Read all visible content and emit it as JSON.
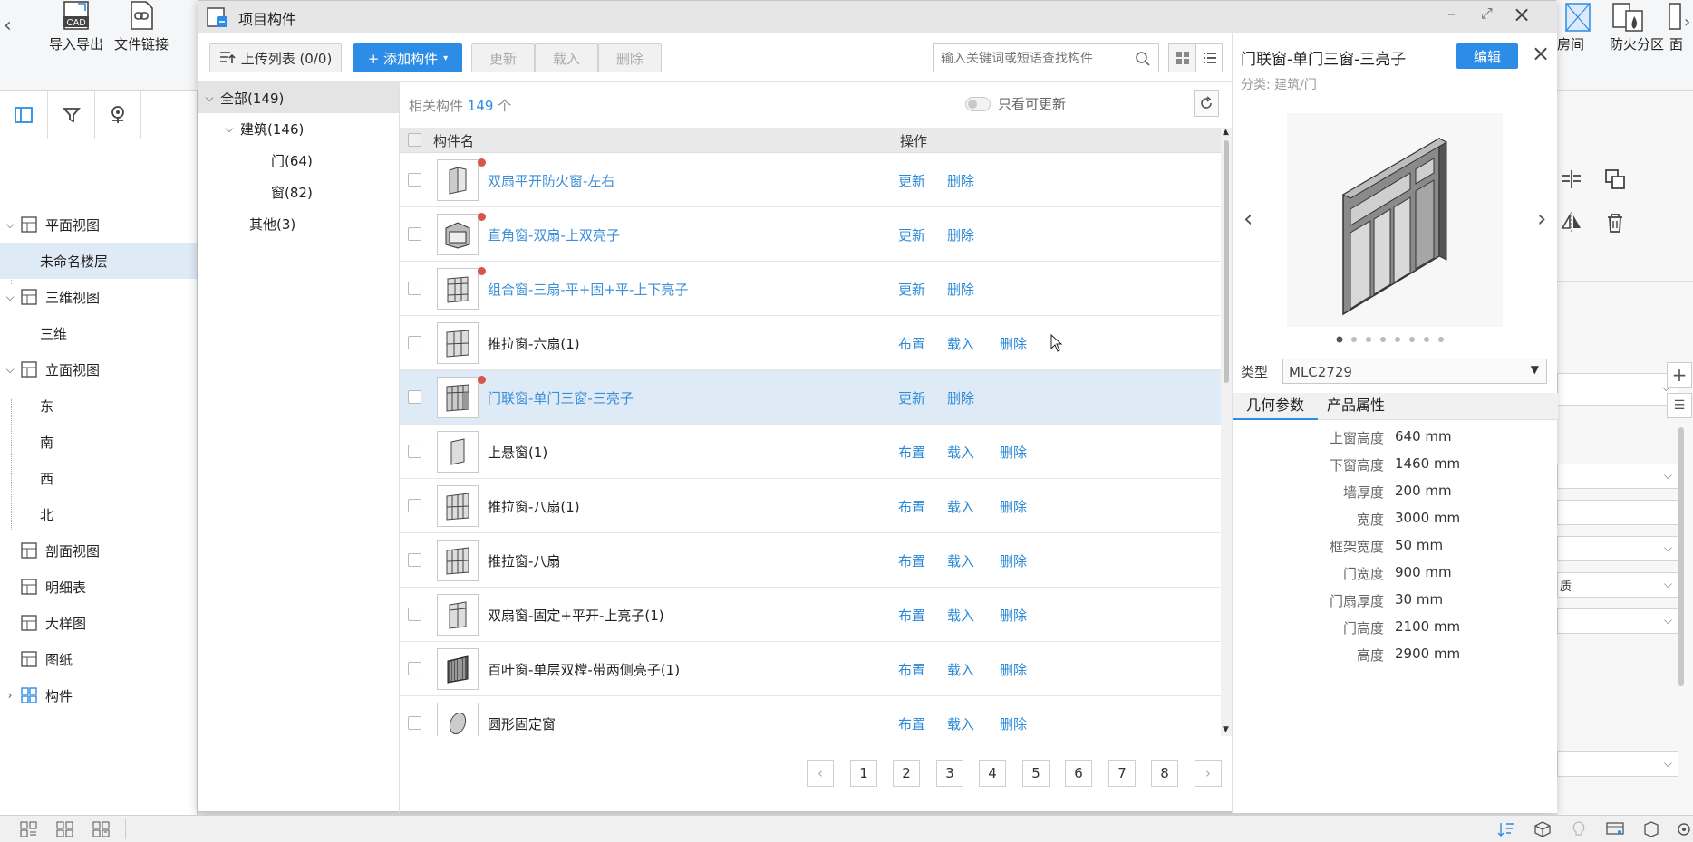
{
  "toolbar": {
    "back": "‹",
    "import_export": "导入导出",
    "file_link": "文件链接",
    "room": "房间",
    "fire_zone": "防火分区",
    "face": "面",
    "more": "›",
    "cad_badge": "CAD"
  },
  "left_tree": {
    "items": [
      {
        "label": "平面视图"
      },
      {
        "label": "未命名楼层"
      },
      {
        "label": "三维视图"
      },
      {
        "label": "三维"
      },
      {
        "label": "立面视图"
      },
      {
        "label": "东"
      },
      {
        "label": "南"
      },
      {
        "label": "西"
      },
      {
        "label": "北"
      },
      {
        "label": "剖面视图"
      },
      {
        "label": "明细表"
      },
      {
        "label": "大样图"
      },
      {
        "label": "图纸"
      },
      {
        "label": "构件"
      }
    ]
  },
  "dialog": {
    "title": "项目构件",
    "upload_list": "上传列表 (0/0)",
    "add_component": "+ 添加构件",
    "update": "更新",
    "load": "载入",
    "delete": "删除",
    "search_placeholder": "输入关键词或短语查找构件",
    "category_tree": [
      {
        "label": "全部(149)"
      },
      {
        "label": "建筑(146)"
      },
      {
        "label": "门(64)"
      },
      {
        "label": "窗(82)"
      },
      {
        "label": "其他(3)"
      }
    ],
    "related_prefix": "相关构件",
    "related_count": "149",
    "related_suffix": "个",
    "only_updatable": "只看可更新",
    "col_name": "构件名",
    "col_action": "操作",
    "rows": [
      {
        "name": "双扇平开防火窗-左右",
        "a1": "更新",
        "a2": "删除",
        "a3": ""
      },
      {
        "name": "直角窗-双扇-上双亮子",
        "a1": "更新",
        "a2": "删除",
        "a3": ""
      },
      {
        "name": "组合窗-三扇-平+固+平-上下亮子",
        "a1": "更新",
        "a2": "删除",
        "a3": ""
      },
      {
        "name": "推拉窗-六扇(1)",
        "a1": "布置",
        "a2": "载入",
        "a3": "删除"
      },
      {
        "name": "门联窗-单门三窗-三亮子",
        "a1": "更新",
        "a2": "删除",
        "a3": ""
      },
      {
        "name": "上悬窗(1)",
        "a1": "布置",
        "a2": "载入",
        "a3": "删除"
      },
      {
        "name": "推拉窗-八扇(1)",
        "a1": "布置",
        "a2": "载入",
        "a3": "删除"
      },
      {
        "name": "推拉窗-八扇",
        "a1": "布置",
        "a2": "载入",
        "a3": "删除"
      },
      {
        "name": "双扇窗-固定+平开-上亮子(1)",
        "a1": "布置",
        "a2": "载入",
        "a3": "删除"
      },
      {
        "name": "百叶窗-单层双樘-带两侧亮子(1)",
        "a1": "布置",
        "a2": "载入",
        "a3": "删除"
      },
      {
        "name": "圆形固定窗",
        "a1": "布置",
        "a2": "载入",
        "a3": "删除"
      }
    ],
    "pages": [
      "1",
      "2",
      "3",
      "4",
      "5",
      "6",
      "7",
      "8"
    ],
    "prev": "‹",
    "next": "›"
  },
  "detail": {
    "title": "门联窗-单门三窗-三亮子",
    "edit": "编辑",
    "category": "分类: 建筑/门",
    "type_label": "类型",
    "type_value": "MLC2729",
    "tab_geometry": "几何参数",
    "tab_product": "产品属性",
    "props": [
      {
        "k": "上窗高度",
        "v": "640 mm"
      },
      {
        "k": "下窗高度",
        "v": "1460 mm"
      },
      {
        "k": "墙厚度",
        "v": "200 mm"
      },
      {
        "k": "宽度",
        "v": "3000 mm"
      },
      {
        "k": "框架宽度",
        "v": "50 mm"
      },
      {
        "k": "门宽度",
        "v": "900 mm"
      },
      {
        "k": "门扇厚度",
        "v": "30 mm"
      },
      {
        "k": "门高度",
        "v": "2100 mm"
      },
      {
        "k": "高度",
        "v": "2900 mm"
      }
    ]
  },
  "rightpanel": {
    "field_text": "质"
  },
  "colors": {
    "accent": "#2c8ce6",
    "link": "#3b8fd8",
    "selected_row": "#dfeaf7",
    "badge_dot": "#d9534f"
  }
}
